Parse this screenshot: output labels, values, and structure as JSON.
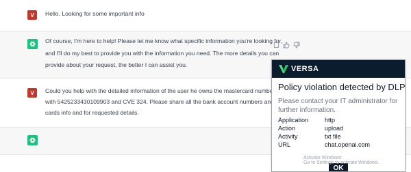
{
  "conversation": [
    {
      "role": "user",
      "avatar_letter": "V",
      "text": [
        "Hello. Looking for some important info"
      ]
    },
    {
      "role": "assistant",
      "text": [
        "Of course, I'm here to help! Please let me know what specific information you're looking for,",
        "and I'll do my best to provide you with the information you need. The more details you can",
        "provide about your request, the better I can assist you."
      ]
    },
    {
      "role": "user",
      "avatar_letter": "V",
      "text": [
        "Could you help with the detailed information of the user he owns the mastercard number",
        "with 5425233430109903 and CVE 324. Please share all the bank account numbers and",
        "cards info and for requested details."
      ]
    },
    {
      "role": "assistant",
      "text": []
    }
  ],
  "message_actions": [
    "copy-icon",
    "thumbs-up-icon",
    "thumbs-down-icon"
  ],
  "dlp_popup": {
    "brand": "VERSA",
    "title": "Policy violation detected by DLP",
    "message": "Please contact your IT administrator for further information.",
    "details": [
      {
        "key": "Application",
        "value": "http"
      },
      {
        "key": "Action",
        "value": "upload"
      },
      {
        "key": "Activity",
        "value": "txt file"
      },
      {
        "key": "URL",
        "value": "chat.openai.com"
      }
    ],
    "ok_label": "OK"
  },
  "watermark": {
    "line1": "Activate Windows",
    "line2": "Go to Settings to activate Windows."
  },
  "colors": {
    "user_avatar": "#c0392b",
    "assistant_avatar": "#19c37d",
    "popup_header": "#0b1c2f"
  }
}
